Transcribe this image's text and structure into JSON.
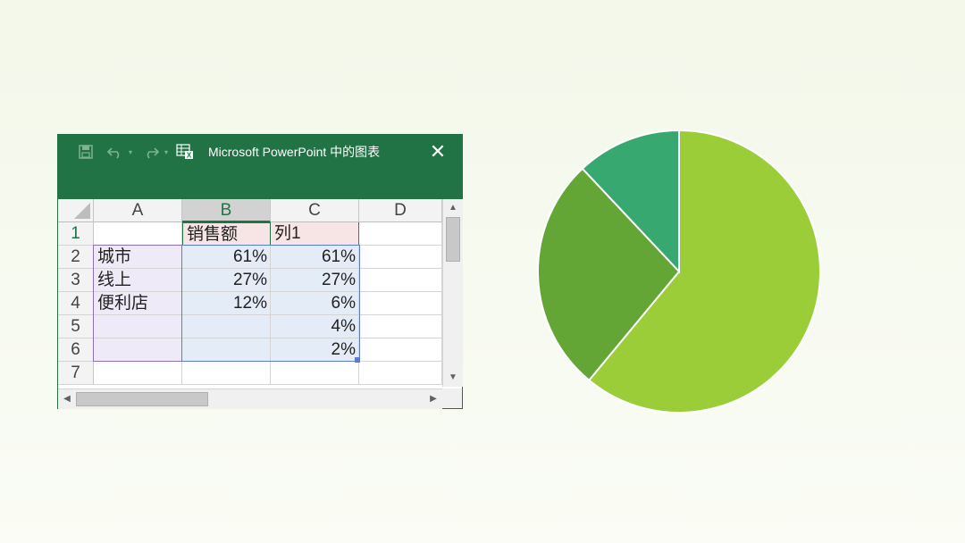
{
  "window": {
    "title": "Microsoft PowerPoint 中的图表",
    "close_glyph": "✕"
  },
  "toolbar": {
    "save_icon": "save-icon",
    "undo_icon": "undo-icon",
    "redo_icon": "redo-icon",
    "edit_data_icon": "edit-data-icon"
  },
  "sheet": {
    "columns": [
      "A",
      "B",
      "C",
      "D"
    ],
    "rows": [
      "1",
      "2",
      "3",
      "4",
      "5",
      "6",
      "7"
    ],
    "cells": {
      "B1": "销售额",
      "C1": "列1",
      "A2": "城市",
      "B2": "61%",
      "C2": "61%",
      "A3": "线上",
      "B3": "27%",
      "C3": "27%",
      "A4": "便利店",
      "B4": "12%",
      "C4": "6%",
      "C5": "4%",
      "C6": "2%"
    }
  },
  "colors": {
    "excel_green": "#217346",
    "slice_1": "#9bcd38",
    "slice_2": "#63a636",
    "slice_3": "#36a870",
    "category_fill": "#efeaf7",
    "category_border": "#8f6dbf",
    "value_fill": "#e4ecf7",
    "value_border": "#5b7bd5",
    "header_fill": "#f7e4e4",
    "header_border": "#c23c3c"
  },
  "chart_data": {
    "type": "pie",
    "categories": [
      "城市",
      "线上",
      "便利店"
    ],
    "values": [
      61,
      27,
      12
    ],
    "title": "",
    "legend": "none"
  }
}
